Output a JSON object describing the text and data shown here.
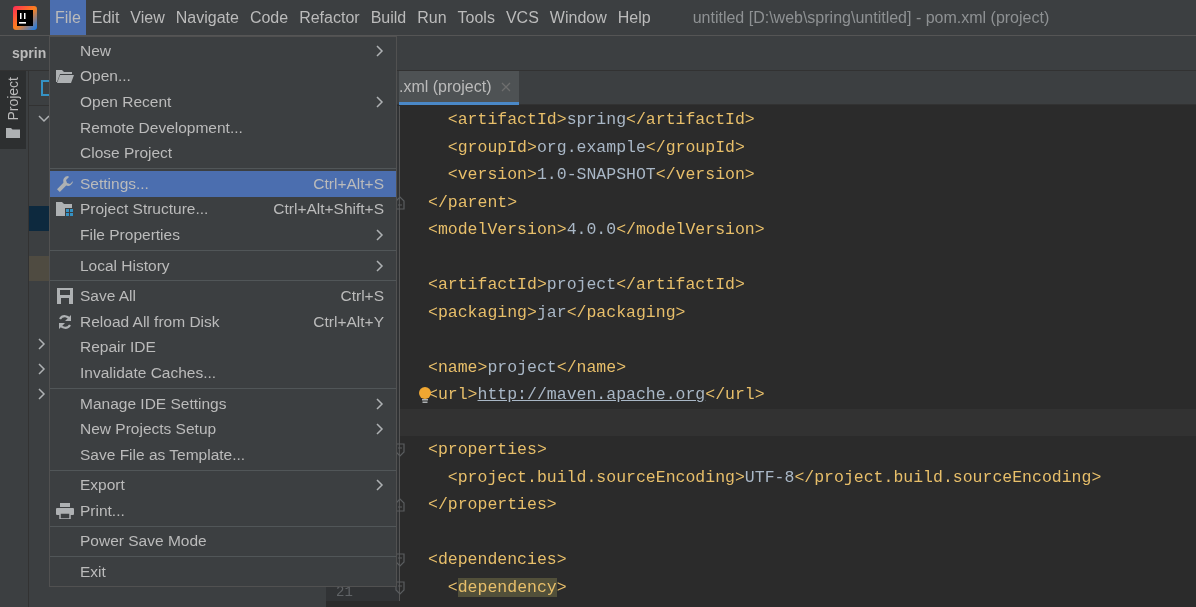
{
  "menu_bar": {
    "items": [
      {
        "label": "File",
        "selected": true
      },
      {
        "label": "Edit",
        "selected": false
      },
      {
        "label": "View",
        "selected": false
      },
      {
        "label": "Navigate",
        "selected": false
      },
      {
        "label": "Code",
        "selected": false
      },
      {
        "label": "Refactor",
        "selected": false
      },
      {
        "label": "Build",
        "selected": false
      },
      {
        "label": "Run",
        "selected": false
      },
      {
        "label": "Tools",
        "selected": false
      },
      {
        "label": "VCS",
        "selected": false
      },
      {
        "label": "Window",
        "selected": false
      },
      {
        "label": "Help",
        "selected": false
      }
    ]
  },
  "window": {
    "title": "untitled [D:\\web\\spring\\untitled] - pom.xml (project)"
  },
  "breadcrumb": "sprin",
  "tool_stripe": {
    "label": "Project",
    "selected": true
  },
  "project_tree": {
    "rows": [
      {
        "kind": "expanded"
      },
      {
        "kind": "plain"
      },
      {
        "kind": "plain"
      },
      {
        "kind": "plain"
      },
      {
        "kind": "selected"
      },
      {
        "kind": "plain"
      },
      {
        "kind": "found"
      },
      {
        "kind": "plain"
      },
      {
        "kind": "plain"
      },
      {
        "kind": "collapsed"
      },
      {
        "kind": "collapsed"
      },
      {
        "kind": "collapsed"
      }
    ]
  },
  "editor_tab": {
    "label": ".xml (project)",
    "selected": true
  },
  "file_menu": {
    "items": [
      {
        "kind": "plain",
        "label": "New",
        "submenu": true,
        "selected": false
      },
      {
        "kind": "folder",
        "label": "Open...",
        "selected": false
      },
      {
        "kind": "plain",
        "label": "Open Recent",
        "submenu": true,
        "selected": false
      },
      {
        "kind": "plain",
        "label": "Remote Development...",
        "selected": false
      },
      {
        "kind": "plain",
        "label": "Close Project",
        "selected": false
      },
      {
        "kind": "separator"
      },
      {
        "kind": "wrench",
        "label": "Settings...",
        "shortcut": "Ctrl+Alt+S",
        "selected": true
      },
      {
        "kind": "structure",
        "label": "Project Structure...",
        "shortcut": "Ctrl+Alt+Shift+S",
        "selected": false
      },
      {
        "kind": "plain",
        "label": "File Properties",
        "submenu": true,
        "selected": false
      },
      {
        "kind": "separator"
      },
      {
        "kind": "plain",
        "label": "Local History",
        "submenu": true,
        "selected": false
      },
      {
        "kind": "separator"
      },
      {
        "kind": "floppy",
        "label": "Save All",
        "shortcut": "Ctrl+S",
        "selected": false
      },
      {
        "kind": "reload",
        "label": "Reload All from Disk",
        "shortcut": "Ctrl+Alt+Y",
        "selected": false
      },
      {
        "kind": "plain",
        "label": "Repair IDE",
        "selected": false
      },
      {
        "kind": "plain",
        "label": "Invalidate Caches...",
        "selected": false
      },
      {
        "kind": "separator"
      },
      {
        "kind": "plain",
        "label": "Manage IDE Settings",
        "submenu": true,
        "selected": false
      },
      {
        "kind": "plain",
        "label": "New Projects Setup",
        "submenu": true,
        "selected": false
      },
      {
        "kind": "plain",
        "label": "Save File as Template...",
        "selected": false
      },
      {
        "kind": "separator"
      },
      {
        "kind": "plain",
        "label": "Export",
        "submenu": true,
        "selected": false
      },
      {
        "kind": "printer",
        "label": "Print...",
        "selected": false
      },
      {
        "kind": "separator"
      },
      {
        "kind": "plain",
        "label": "Power Save Mode",
        "selected": false
      },
      {
        "kind": "separator"
      },
      {
        "kind": "plain",
        "label": "Exit",
        "selected": false
      }
    ]
  },
  "code_lines": [
    {
      "tokens": [
        {
          "kind": "tag",
          "text": "  <artifactId>"
        },
        {
          "kind": "text",
          "text": "spring"
        },
        {
          "kind": "tag",
          "text": "</artifactId>"
        }
      ]
    },
    {
      "tokens": [
        {
          "kind": "tag",
          "text": "  <groupId>"
        },
        {
          "kind": "text",
          "text": "org.example"
        },
        {
          "kind": "tag",
          "text": "</groupId>"
        }
      ]
    },
    {
      "tokens": [
        {
          "kind": "tag",
          "text": "  <version>"
        },
        {
          "kind": "text",
          "text": "1.0-SNAPSHOT"
        },
        {
          "kind": "tag",
          "text": "</version>"
        }
      ]
    },
    {
      "kind": "fold-end",
      "tokens": [
        {
          "kind": "tag",
          "text": "</parent>"
        }
      ]
    },
    {
      "tokens": [
        {
          "kind": "tag",
          "text": "<modelVersion>"
        },
        {
          "kind": "text",
          "text": "4.0.0"
        },
        {
          "kind": "tag",
          "text": "</modelVersion>"
        }
      ]
    },
    {
      "kind": "blank"
    },
    {
      "tokens": [
        {
          "kind": "tag",
          "text": "<artifactId>"
        },
        {
          "kind": "text",
          "text": "project"
        },
        {
          "kind": "tag",
          "text": "</artifactId>"
        }
      ]
    },
    {
      "tokens": [
        {
          "kind": "tag",
          "text": "<packaging>"
        },
        {
          "kind": "text",
          "text": "jar"
        },
        {
          "kind": "tag",
          "text": "</packaging>"
        }
      ]
    },
    {
      "kind": "blank"
    },
    {
      "tokens": [
        {
          "kind": "tag",
          "text": "<name>"
        },
        {
          "kind": "text",
          "text": "project"
        },
        {
          "kind": "tag",
          "text": "</name>"
        }
      ]
    },
    {
      "hint": true,
      "tokens": [
        {
          "kind": "tag",
          "text": "<url>"
        },
        {
          "kind": "link",
          "text": "http://maven.apache.org"
        },
        {
          "kind": "tag",
          "text": "</url>"
        }
      ]
    },
    {
      "kind": "blank",
      "current": true
    },
    {
      "kind": "fold-start",
      "tokens": [
        {
          "kind": "tag",
          "text": "<properties>"
        }
      ]
    },
    {
      "tokens": [
        {
          "kind": "tag",
          "text": "  <project.build.sourceEncoding>"
        },
        {
          "kind": "text",
          "text": "UTF-8"
        },
        {
          "kind": "tag",
          "text": "</project.build.sourceEncoding>"
        }
      ]
    },
    {
      "kind": "fold-end",
      "tokens": [
        {
          "kind": "tag",
          "text": "</properties>"
        }
      ]
    },
    {
      "kind": "blank"
    },
    {
      "kind": "fold-start",
      "tokens": [
        {
          "kind": "tag",
          "text": "<dependencies>"
        }
      ]
    },
    {
      "kind": "fold-start",
      "line_number": "21",
      "tokens": [
        {
          "kind": "tag",
          "text": "  <"
        },
        {
          "kind": "match",
          "text": "dependency"
        },
        {
          "kind": "tag",
          "text": ">"
        }
      ]
    }
  ]
}
